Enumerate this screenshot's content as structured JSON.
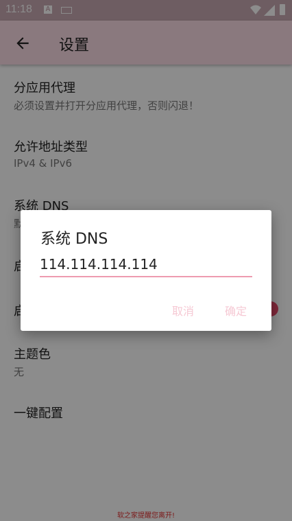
{
  "status_bar": {
    "time": "11:18",
    "notification_letter": "A"
  },
  "toolbar": {
    "title": "设置"
  },
  "settings": [
    {
      "title": "分应用代理",
      "subtitle": "必须设置并打开分应用代理，否则闪退！"
    },
    {
      "title": "允许地址类型",
      "subtitle": "IPv4 & IPv6"
    },
    {
      "title": "系统 DNS",
      "subtitle": "默"
    },
    {
      "title": "启",
      "subtitle": ""
    },
    {
      "title": "启",
      "subtitle": "",
      "switch_on": true
    },
    {
      "title": "主题色",
      "subtitle": "无"
    },
    {
      "title": "一键配置",
      "subtitle": ""
    }
  ],
  "footer_note": "软之家提醒您离开!",
  "dialog": {
    "title": "系统 DNS",
    "input_value": "114.114.114.114",
    "cancel_label": "取消",
    "ok_label": "确定"
  },
  "colors": {
    "accent": "#e84a6b",
    "toolbar": "#fcdde6",
    "statusbar": "#c9a9b3"
  }
}
